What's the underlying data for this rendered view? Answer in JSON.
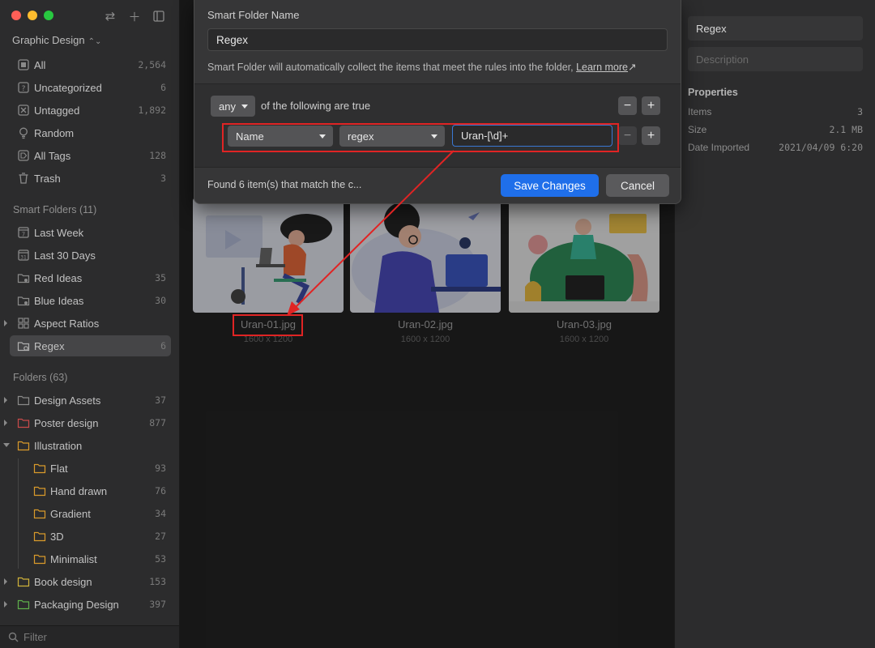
{
  "window": {
    "library_title": "Graphic Design"
  },
  "sidebar": {
    "library": [
      {
        "label": "All",
        "count": "2,564"
      },
      {
        "label": "Uncategorized",
        "count": "6"
      },
      {
        "label": "Untagged",
        "count": "1,892"
      },
      {
        "label": "Random",
        "count": ""
      },
      {
        "label": "All Tags",
        "count": "128"
      },
      {
        "label": "Trash",
        "count": "3"
      }
    ],
    "smart_title": "Smart Folders (11)",
    "smart": [
      {
        "label": "Last Week",
        "count": ""
      },
      {
        "label": "Last 30 Days",
        "count": ""
      },
      {
        "label": "Red Ideas",
        "count": "35"
      },
      {
        "label": "Blue Ideas",
        "count": "30"
      },
      {
        "label": "Aspect Ratios",
        "count": ""
      },
      {
        "label": "Regex",
        "count": "6"
      }
    ],
    "folders_title": "Folders (63)",
    "folders": [
      {
        "label": "Design Assets",
        "count": "37",
        "color": "#8a8a8a"
      },
      {
        "label": "Poster design",
        "count": "877",
        "color": "#c94a4a"
      },
      {
        "label": "Illustration",
        "count": "",
        "color": "#d99a2b"
      },
      {
        "label": "Flat",
        "count": "93",
        "color": "#d99a2b"
      },
      {
        "label": "Hand drawn",
        "count": "76",
        "color": "#d99a2b"
      },
      {
        "label": "Gradient",
        "count": "34",
        "color": "#d99a2b"
      },
      {
        "label": "3D",
        "count": "27",
        "color": "#d99a2b"
      },
      {
        "label": "Minimalist",
        "count": "53",
        "color": "#d99a2b"
      },
      {
        "label": "Book design",
        "count": "153",
        "color": "#d0b23a"
      },
      {
        "label": "Packaging Design",
        "count": "397",
        "color": "#5fb04b"
      }
    ],
    "filter_placeholder": "Filter"
  },
  "modal": {
    "name_label": "Smart Folder Name",
    "name_value": "Regex",
    "help_text": "Smart Folder will automatically collect the items that meet the rules into the folder,",
    "learn_more": "Learn more",
    "match_mode": "any",
    "match_text": "of the following are true",
    "rule_field": "Name",
    "rule_operator": "regex",
    "rule_value": "Uran-[\\d]+",
    "found_text": "Found 6 item(s) that match the c...",
    "save_label": "Save Changes",
    "cancel_label": "Cancel"
  },
  "thumbnails": [
    {
      "name": "Uran-01.jpg",
      "dims": "1600 x 1200"
    },
    {
      "name": "Uran-02.jpg",
      "dims": "1600 x 1200"
    },
    {
      "name": "Uran-03.jpg",
      "dims": "1600 x 1200"
    }
  ],
  "inspector": {
    "name_value": "Regex",
    "description_placeholder": "Description",
    "properties_title": "Properties",
    "properties": [
      {
        "key": "Items",
        "value": "3"
      },
      {
        "key": "Size",
        "value": "2.1 MB"
      },
      {
        "key": "Date Imported",
        "value": "2021/04/09 6:20"
      }
    ]
  },
  "colors": {
    "accent": "#1f6fea",
    "annotation": "#e02424"
  }
}
